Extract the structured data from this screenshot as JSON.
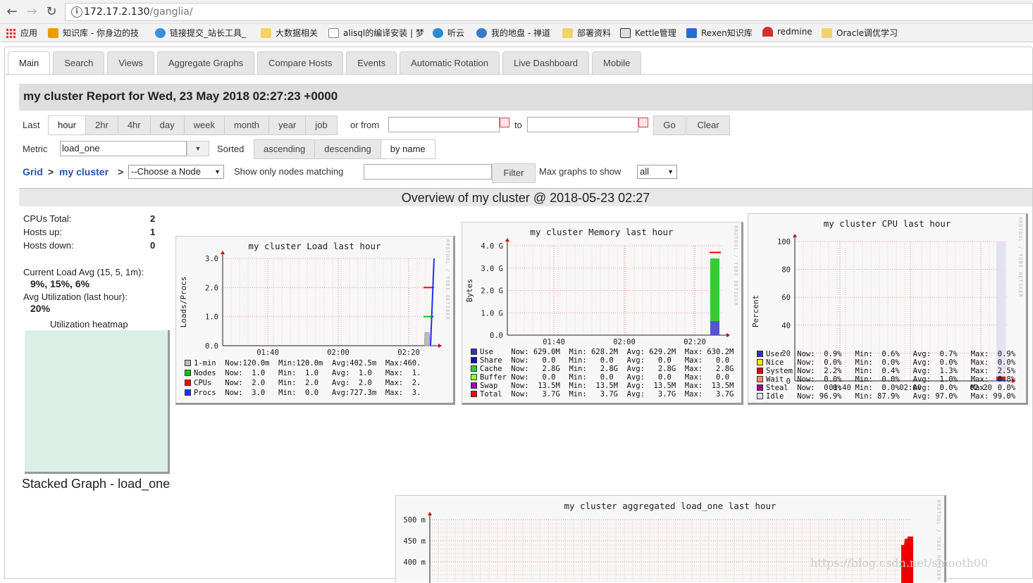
{
  "browser": {
    "url_host": "172.17.2.130",
    "url_path": "/ganglia/",
    "bookmarks": [
      "应用",
      "知识库 - 你身边的技",
      "链接提交_站长工具_",
      "大数据相关",
      "alisql的编译安装 | 梦",
      "听云",
      "我的地盘 - 禅道",
      "部署资料",
      "Kettle管理",
      "Rexen知识库",
      "redmine",
      "Oracle调优学习"
    ]
  },
  "tabs": [
    "Main",
    "Search",
    "Views",
    "Aggregate Graphs",
    "Compare Hosts",
    "Events",
    "Automatic Rotation",
    "Live Dashboard",
    "Mobile"
  ],
  "report_title": "my cluster Report for Wed, 23 May 2018 02:27:23 +0000",
  "controls": {
    "last_label": "Last",
    "ranges": [
      "hour",
      "2hr",
      "4hr",
      "day",
      "week",
      "month",
      "year",
      "job"
    ],
    "or_from": "or from",
    "to": "to",
    "go": "Go",
    "clear": "Clear",
    "metric_label": "Metric",
    "metric_value": "load_one",
    "sorted_label": "Sorted",
    "sort_options": [
      "ascending",
      "descending",
      "by name"
    ],
    "grid": "Grid",
    "cluster": "my cluster",
    "node_select": "--Choose a Node",
    "show_only": "Show only nodes matching",
    "filter": "Filter",
    "max_graphs": "Max graphs to show",
    "max_graphs_value": "all"
  },
  "overview_title": "Overview of my cluster @ 2018-05-23 02:27",
  "stats": {
    "cpus_label": "CPUs Total:",
    "cpus": "2",
    "up_label": "Hosts up:",
    "up": "1",
    "down_label": "Hosts down:",
    "down": "0",
    "load_label": "Current Load Avg (15, 5, 1m):",
    "load": "9%, 15%, 6%",
    "util_label": "Avg Utilization (last hour):",
    "util": "20%",
    "heatmap_label": "Utilization heatmap"
  },
  "stacked_title": "Stacked Graph - load_one",
  "watermark": "https://blog.csdn.net/smooth00",
  "graphs": {
    "load": {
      "title": "my cluster Load last hour",
      "ylabel": "Loads/Procs",
      "yticks": [
        "3.0",
        "2.0",
        "1.0",
        "0.0"
      ],
      "xticks": [
        "01:40",
        "02:00",
        "02:20"
      ],
      "legend": [
        {
          "name": "1-min",
          "color": "#bbbbbb",
          "text": "Now:120.0m  Min:120.0m  Avg:402.5m  Max:460."
        },
        {
          "name": "Nodes",
          "color": "#00cc00",
          "text": "Now:  1.0   Min:  1.0   Avg:  1.0   Max:  1."
        },
        {
          "name": "CPUs",
          "color": "#ff0000",
          "text": "Now:  2.0   Min:  2.0   Avg:  2.0   Max:  2."
        },
        {
          "name": "Procs",
          "color": "#2030f0",
          "text": "Now:  3.0   Min:  0.0   Avg:727.3m  Max:  3."
        }
      ]
    },
    "memory": {
      "title": "my cluster Memory last hour",
      "ylabel": "Bytes",
      "yticks": [
        "4.0 G",
        "3.0 G",
        "2.0 G",
        "1.0 G",
        "0.0"
      ],
      "xticks": [
        "01:40",
        "02:00",
        "02:20"
      ],
      "legend": [
        {
          "name": "Use",
          "color": "#3333bb",
          "text": "Now: 629.0M  Min: 628.2M  Avg: 629.2M  Max: 630.2M"
        },
        {
          "name": "Share",
          "color": "#1111aa",
          "text": "Now:   0.0   Min:   0.0   Avg:   0.0   Max:   0.0"
        },
        {
          "name": "Cache",
          "color": "#33cc33",
          "text": "Now:   2.8G  Min:   2.8G  Avg:   2.8G  Max:   2.8G"
        },
        {
          "name": "Buffer",
          "color": "#99ff33",
          "text": "Now:   0.0   Min:   0.0   Avg:   0.0   Max:   0.0"
        },
        {
          "name": "Swap",
          "color": "#9900aa",
          "text": "Now:  13.5M  Min:  13.5M  Avg:  13.5M  Max:  13.5M"
        },
        {
          "name": "Total",
          "color": "#ff0000",
          "text": "Now:   3.7G  Min:   3.7G  Avg:   3.7G  Max:   3.7G"
        }
      ]
    },
    "cpu": {
      "title": "my cluster CPU last hour",
      "ylabel": "Percent",
      "yticks": [
        "100",
        "80",
        "60",
        "40",
        "20",
        "0"
      ],
      "xticks": [
        "01:40",
        "02:00",
        "02:20"
      ],
      "legend": [
        {
          "name": "User",
          "color": "#3333bb",
          "text": "Now:  0.9%   Min:  0.6%   Avg:  0.7%   Max:  0.9%"
        },
        {
          "name": "Nice",
          "color": "#ffea00",
          "text": "Now:  0.0%   Min:  0.0%   Avg:  0.0%   Max:  0.0%"
        },
        {
          "name": "System",
          "color": "#dd0000",
          "text": "Now:  2.2%   Min:  0.4%   Avg:  1.3%   Max:  2.5%"
        },
        {
          "name": "Wait",
          "color": "#ff8a60",
          "text": "Now:  0.0%   Min:  0.0%   Avg:  1.0%   Max:  8.8%"
        },
        {
          "name": "Steal",
          "color": "#990099",
          "text": "Now:  0.0%   Min:  0.0%   Avg:  0.0%   Max:  0.0%"
        },
        {
          "name": "Idle",
          "color": "#e2e2f2",
          "text": "Now: 96.9%   Min: 87.9%   Avg: 97.0%   Max: 99.0%"
        }
      ]
    },
    "aggregate": {
      "title": "my cluster aggregated load_one last hour",
      "yticks": [
        "500 m",
        "450 m",
        "400 m"
      ]
    }
  },
  "chart_data": [
    {
      "type": "line",
      "title": "my cluster Load last hour",
      "ylabel": "Loads/Procs",
      "ylim": [
        0,
        3
      ],
      "xticks": [
        "01:40",
        "02:00",
        "02:20"
      ],
      "series": [
        {
          "name": "1-min",
          "values": [
            0.12,
            0.46,
            0.12
          ]
        },
        {
          "name": "Nodes",
          "values": [
            1.0,
            1.0
          ]
        },
        {
          "name": "CPUs",
          "values": [
            2.0,
            2.0
          ]
        },
        {
          "name": "Procs",
          "values": [
            0.0,
            3.0
          ]
        }
      ]
    },
    {
      "type": "area",
      "title": "my cluster Memory last hour",
      "ylabel": "Bytes",
      "ylim": [
        0,
        4.0
      ],
      "xticks": [
        "01:40",
        "02:00",
        "02:20"
      ],
      "series": [
        {
          "name": "Use",
          "values": [
            0.629
          ]
        },
        {
          "name": "Cache",
          "values": [
            2.8
          ]
        },
        {
          "name": "Total",
          "values": [
            3.7
          ]
        }
      ]
    },
    {
      "type": "area",
      "title": "my cluster CPU last hour",
      "ylabel": "Percent",
      "ylim": [
        0,
        100
      ],
      "xticks": [
        "01:40",
        "02:00",
        "02:20"
      ],
      "series": [
        {
          "name": "User",
          "values": [
            0.9
          ]
        },
        {
          "name": "System",
          "values": [
            2.2
          ]
        },
        {
          "name": "Idle",
          "values": [
            96.9
          ]
        }
      ]
    },
    {
      "type": "area",
      "title": "my cluster aggregated load_one last hour",
      "ylim": [
        380,
        500
      ],
      "series": [
        {
          "name": "load_one",
          "values": [
            440,
            455,
            460,
            460
          ]
        }
      ]
    }
  ]
}
